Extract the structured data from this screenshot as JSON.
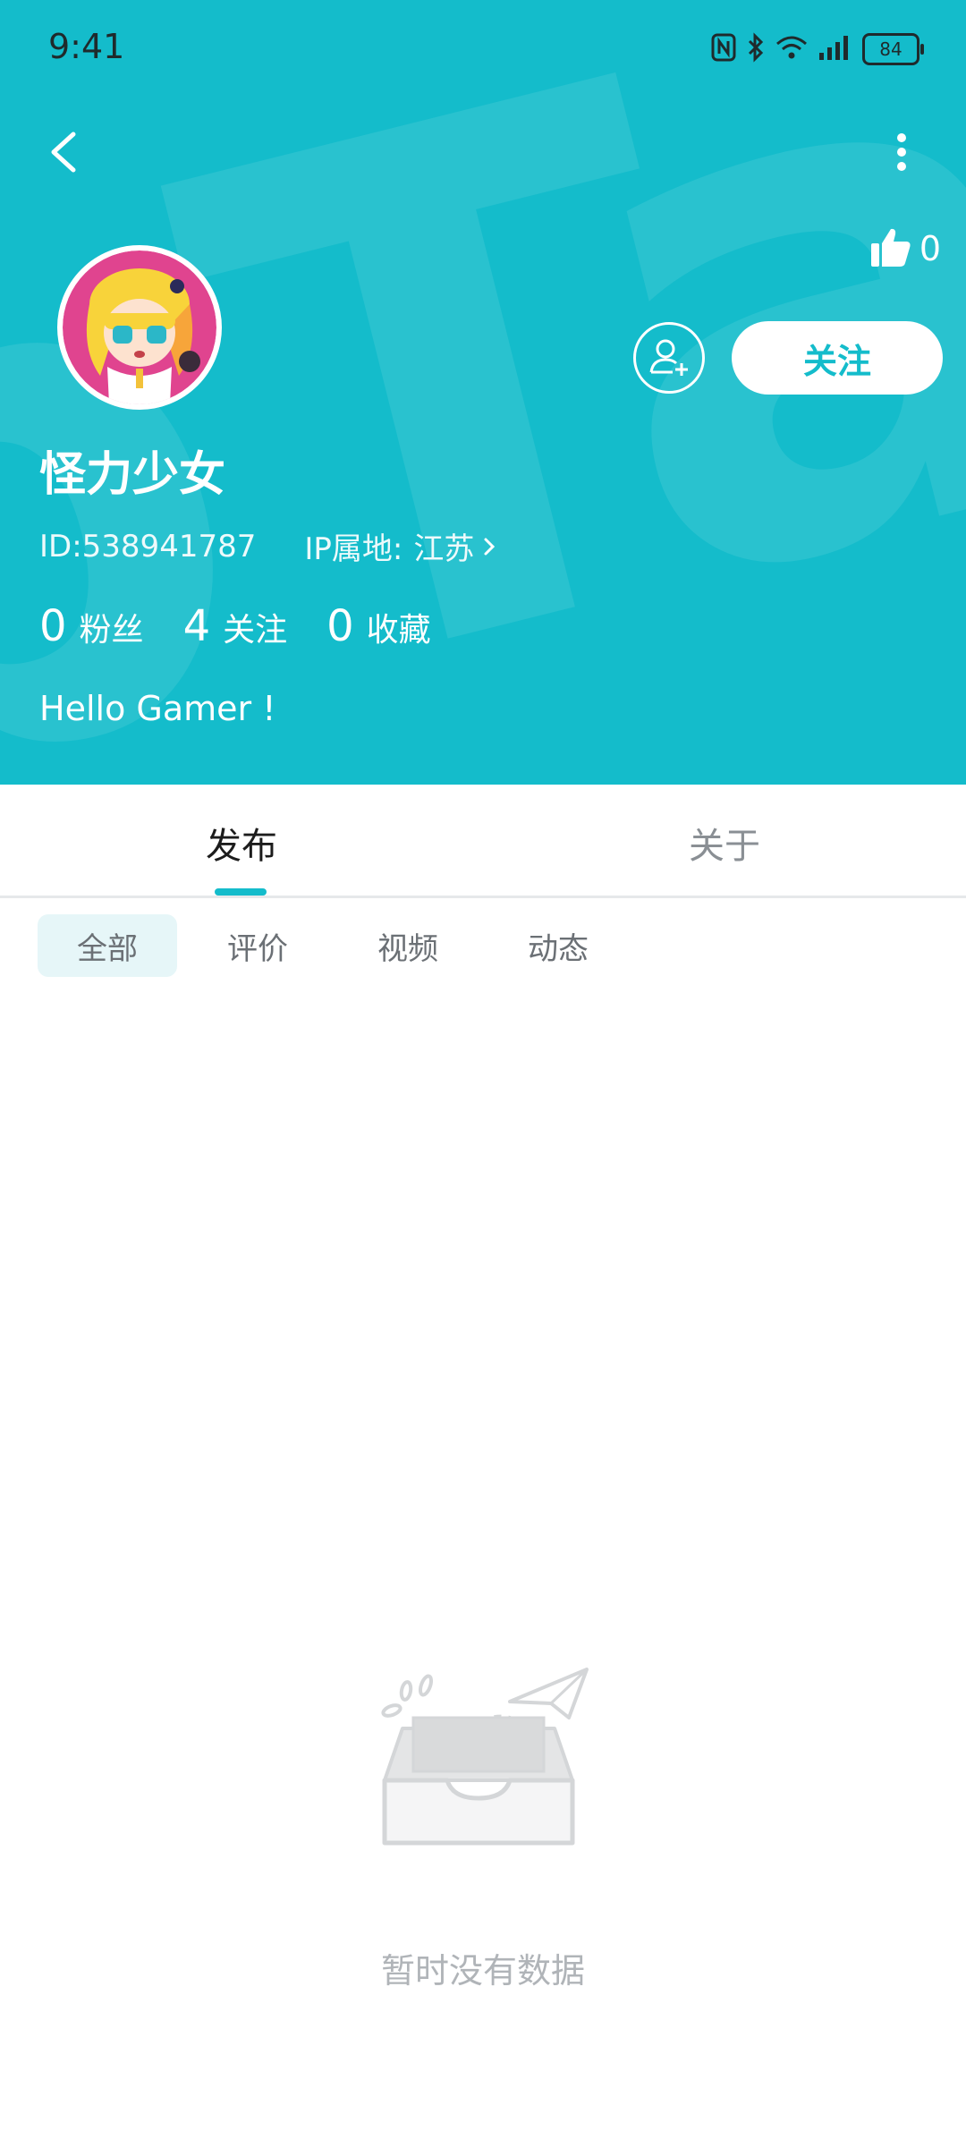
{
  "status_bar": {
    "time": "9:41",
    "battery": "84"
  },
  "profile": {
    "username": "怪力少女",
    "id_text": "ID:538941787",
    "ip_label": "IP属地:",
    "ip_location": "江苏",
    "like_count": "0",
    "follow_label": "关注",
    "bio": "Hello Gamer !",
    "stats": [
      {
        "num": "0",
        "label": "粉丝"
      },
      {
        "num": "4",
        "label": "关注"
      },
      {
        "num": "0",
        "label": "收藏"
      }
    ]
  },
  "tabs": [
    "发布",
    "关于"
  ],
  "subtabs": [
    "全部",
    "评价",
    "视频",
    "动态"
  ],
  "empty_state": {
    "text": "暂时没有数据"
  },
  "colors": {
    "accent": "#14bccb",
    "chip_active_bg": "#e6f6f8"
  }
}
